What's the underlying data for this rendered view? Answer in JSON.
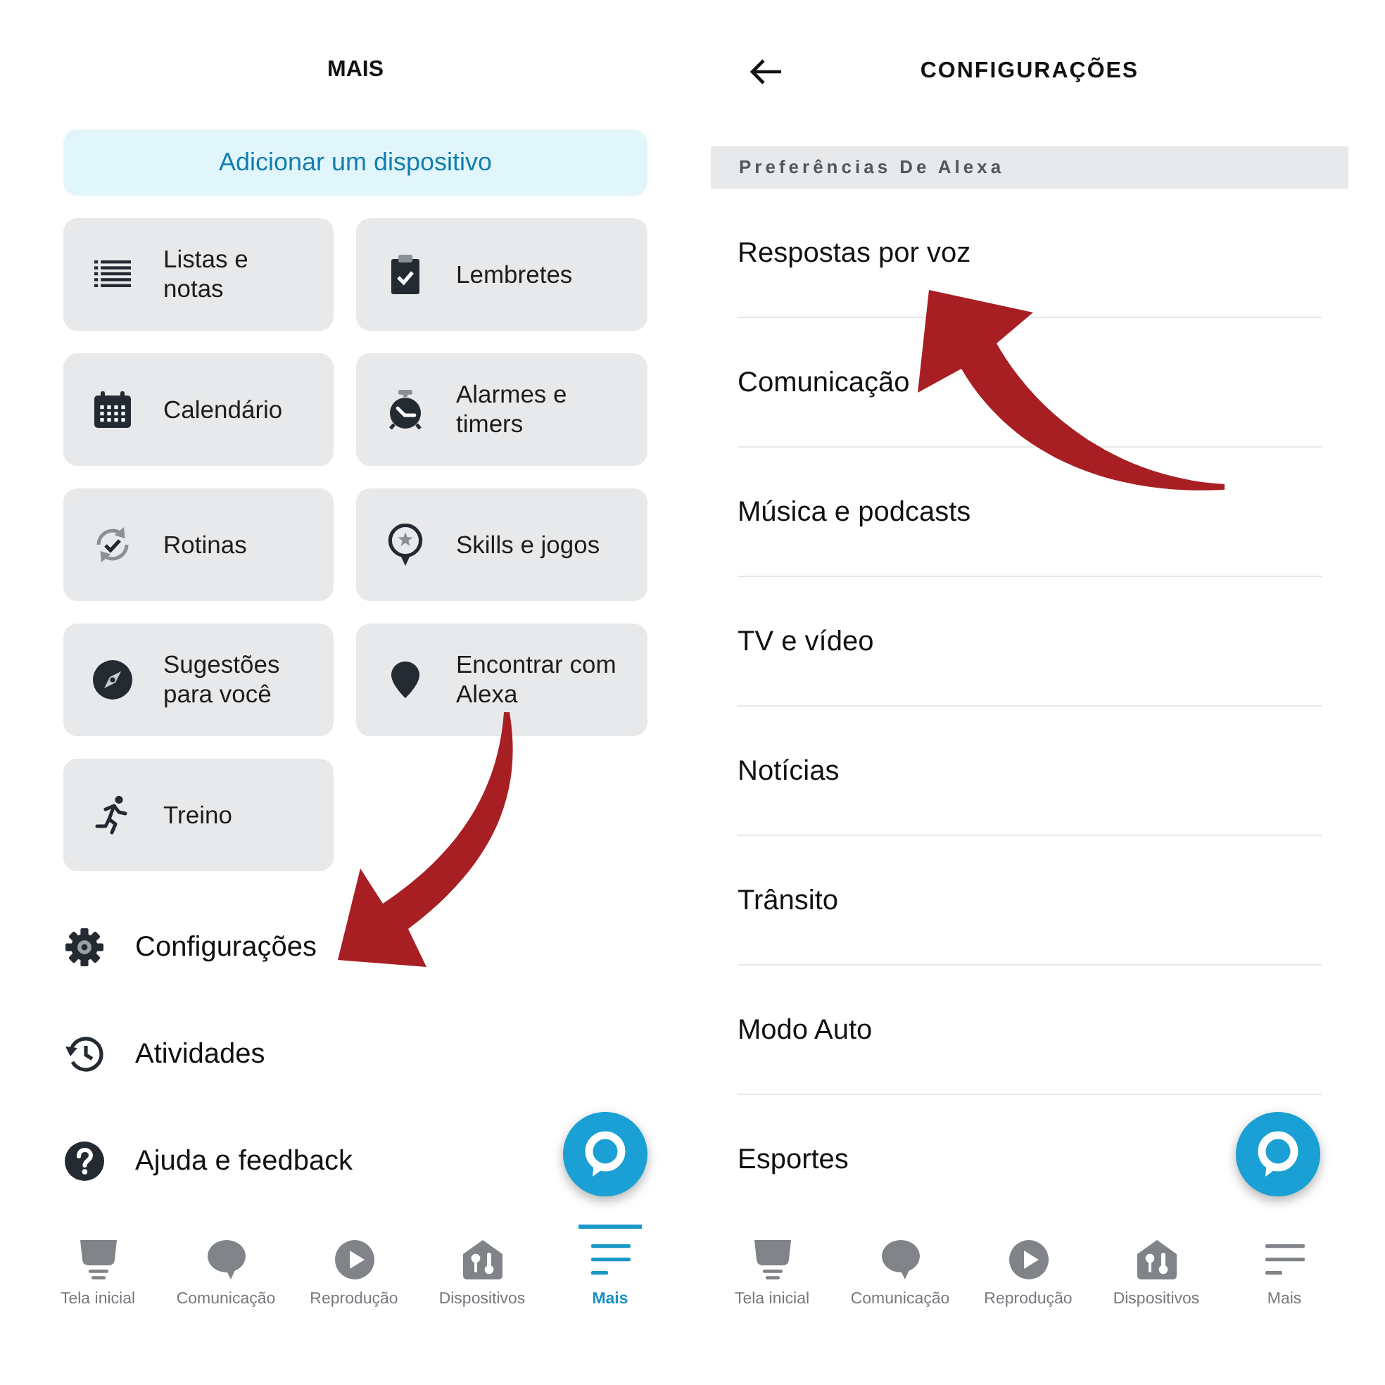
{
  "more_screen": {
    "title": "MAIS",
    "add_device_button": "Adicionar um dispositivo",
    "tiles": [
      "Listas e notas",
      "Calendário",
      "Rotinas",
      "Sugestões para você",
      "Treino",
      "Lembretes",
      "Alarmes e timers",
      "Skills e jogos",
      "Encontrar com Alexa"
    ],
    "menu_items": [
      "Configurações",
      "Atividades",
      "Ajuda e feedback"
    ],
    "nav_tabs": [
      {
        "label": "Tela inicial",
        "selected": false
      },
      {
        "label": "Comunicação",
        "selected": false
      },
      {
        "label": "Reprodução",
        "selected": false
      },
      {
        "label": "Dispositivos",
        "selected": false
      },
      {
        "label": "Mais",
        "selected": true
      }
    ]
  },
  "settings_screen": {
    "title": "CONFIGURAÇÕES",
    "section_header": "Preferências De Alexa",
    "items": [
      "Respostas por voz",
      "Comunicação",
      "Música e podcasts",
      "TV e vídeo",
      "Notícias",
      "Trânsito",
      "Modo Auto",
      "Esportes"
    ],
    "nav_tabs": [
      {
        "label": "Tela inicial",
        "selected": false
      },
      {
        "label": "Comunicação",
        "selected": false
      },
      {
        "label": "Reprodução",
        "selected": false
      },
      {
        "label": "Dispositivos",
        "selected": false
      },
      {
        "label": "Mais",
        "selected": false
      }
    ]
  }
}
